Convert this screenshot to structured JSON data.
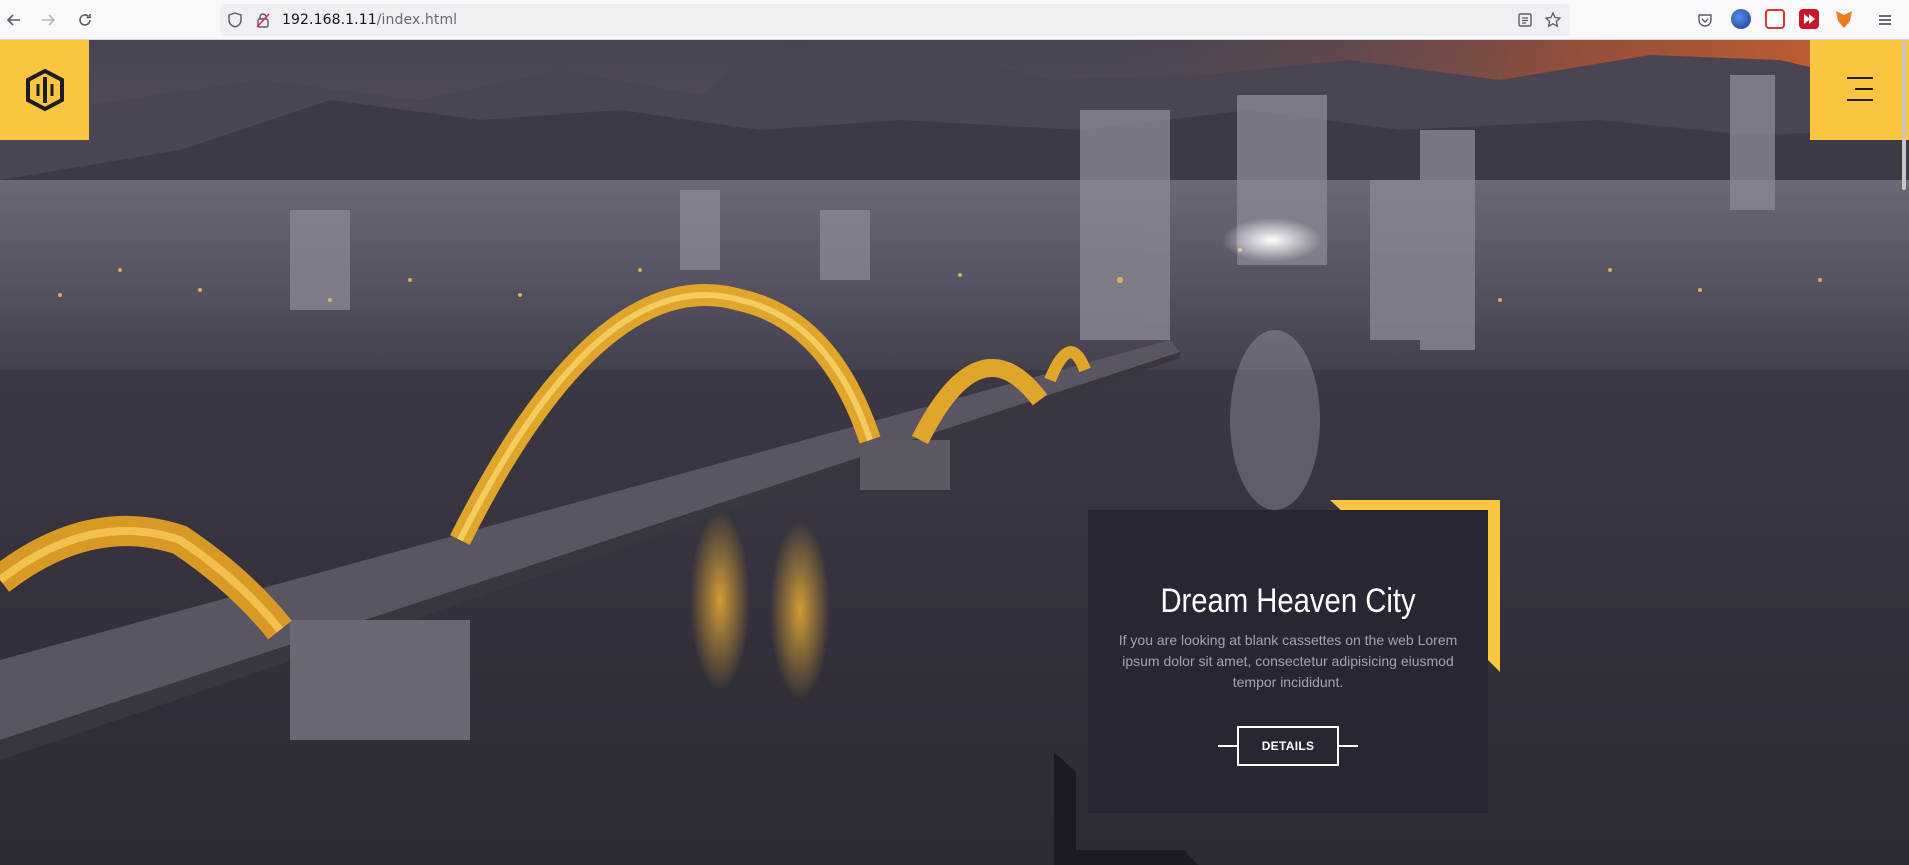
{
  "browser": {
    "url_host": "192.168.1.11",
    "url_path": "/index.html",
    "icons": [
      "back-icon",
      "forward-icon",
      "reload-icon",
      "shield-icon",
      "insecure-lock-icon",
      "reader-view-icon",
      "bookmark-star-icon",
      "pocket-icon",
      "account-icon",
      "extension-icon",
      "extension-icon",
      "metamask-icon",
      "app-menu-icon"
    ]
  },
  "colors": {
    "accent": "#fbc63f",
    "card": "#272633",
    "dark": "#1d1c24"
  },
  "hero": {
    "logo_icon": "hexagon-logo-icon",
    "menu_icon": "hamburger-menu-icon",
    "card": {
      "title": "Dream Heaven City",
      "text": "If you are looking at blank cassettes on the web Lorem ipsum dolor sit amet, consectetur adipisicing eiusmod tempor incididunt.",
      "button_label": "DETAILS"
    }
  }
}
